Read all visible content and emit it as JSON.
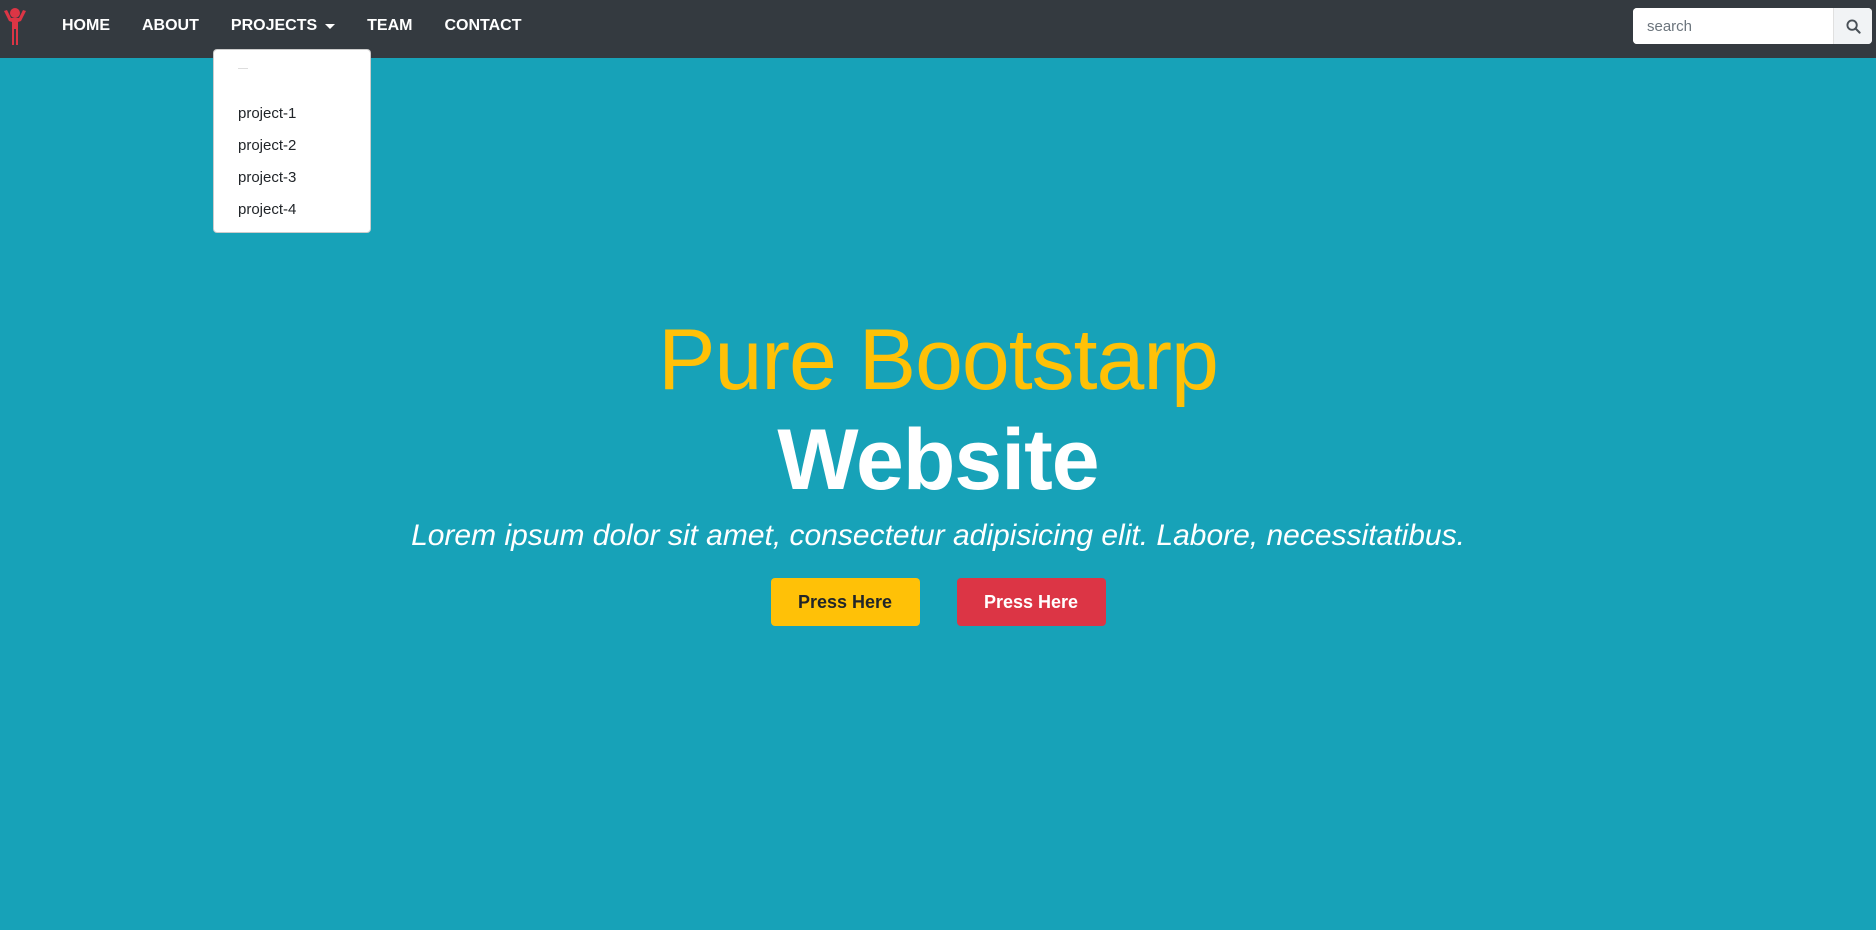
{
  "brand": {
    "logo_icon": "person-arms-up-icon",
    "logo_color": "#dc3545"
  },
  "nav": {
    "items": [
      {
        "label": "HOME"
      },
      {
        "label": "ABOUT"
      },
      {
        "label": "PROJECTS"
      },
      {
        "label": "TEAM"
      },
      {
        "label": "CONTACT"
      }
    ]
  },
  "search": {
    "placeholder": "search",
    "icon": "search-icon"
  },
  "projects_dropdown": {
    "items": [
      {
        "label": "project-1"
      },
      {
        "label": "project-2"
      },
      {
        "label": "project-3"
      },
      {
        "label": "project-4"
      }
    ]
  },
  "hero": {
    "title_line1": "Pure Bootstarp",
    "title_line2": "Website",
    "subtitle": "Lorem ipsum dolor sit amet, consectetur adipisicing elit. Labore, necessitatibus.",
    "button_primary": "Press Here",
    "button_secondary": "Press Here"
  },
  "colors": {
    "navbar": "#343a40",
    "background": "#17a2b8",
    "accent_yellow": "#ffc107",
    "accent_red": "#dc3545"
  }
}
